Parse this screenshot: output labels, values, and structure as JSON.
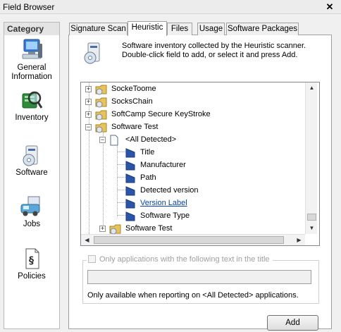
{
  "window": {
    "title": "Field Browser",
    "close_glyph": "✕"
  },
  "sidebar": {
    "header": "Category",
    "items": [
      {
        "label": "General Information",
        "icon": "computer-icon"
      },
      {
        "label": "Inventory",
        "icon": "inventory-icon"
      },
      {
        "label": "Software",
        "icon": "software-icon"
      },
      {
        "label": "Jobs",
        "icon": "jobs-icon"
      },
      {
        "label": "Policies",
        "icon": "policies-icon"
      }
    ]
  },
  "tabs": [
    "Signature Scan",
    "Heuristic",
    "Files",
    "Usage",
    "Software Packages"
  ],
  "active_tab": "Heuristic",
  "info": {
    "line1": "Software inventory collected by the Heuristic scanner.",
    "line2": "Double-click field to add, or select it and press Add."
  },
  "tree": {
    "rows": [
      {
        "label": "SockeToome",
        "expander": "+"
      },
      {
        "label": "SocksChain",
        "expander": "+"
      },
      {
        "label": "SoftCamp Secure KeyStroke",
        "expander": "+"
      },
      {
        "label": "Software Test",
        "expander": "−"
      },
      {
        "label": "<All Detected>",
        "expander": "−"
      },
      {
        "label": "Title"
      },
      {
        "label": "Manufacturer"
      },
      {
        "label": "Path"
      },
      {
        "label": "Detected version"
      },
      {
        "label": "Version Label",
        "selected_link": true
      },
      {
        "label": "Software Type"
      },
      {
        "label": "Software Test",
        "expander": "+"
      }
    ]
  },
  "filter": {
    "checkbox_label": "Only applications with the following text in the title",
    "checked": false,
    "input_value": "",
    "note": "Only available when reporting on <All Detected> applications."
  },
  "buttons": {
    "add": "Add"
  },
  "colors": {
    "folder": "#e8c35a",
    "link": "#0645ad",
    "field_icon": "#2b55a8"
  }
}
